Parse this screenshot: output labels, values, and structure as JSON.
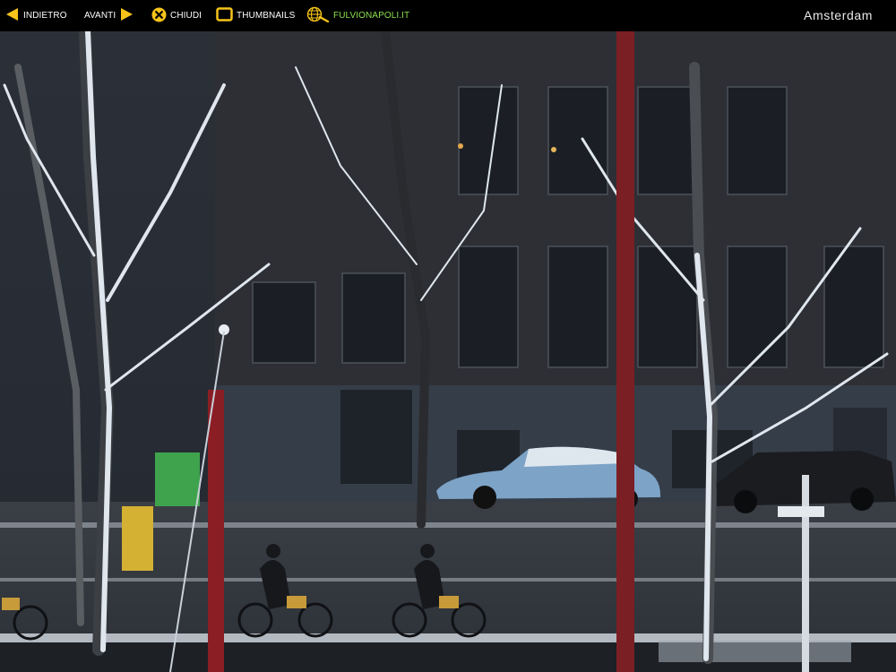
{
  "nav": {
    "back_label": "INDIETRO",
    "next_label": "AVANTI",
    "close_label": "CHIUDI",
    "thumbnails_label": "THUMBNAILS",
    "site_label": "FULVIONAPOLI.IT"
  },
  "icons": {
    "back": "arrow-left-icon",
    "next": "arrow-right-icon",
    "close": "close-circle-icon",
    "thumbnails": "square-icon",
    "site": "globe-search-icon"
  },
  "colors": {
    "accent_yellow": "#f5c31a",
    "site_green": "#8be04e",
    "bar_background": "#000000"
  },
  "album_title": "Amsterdam"
}
